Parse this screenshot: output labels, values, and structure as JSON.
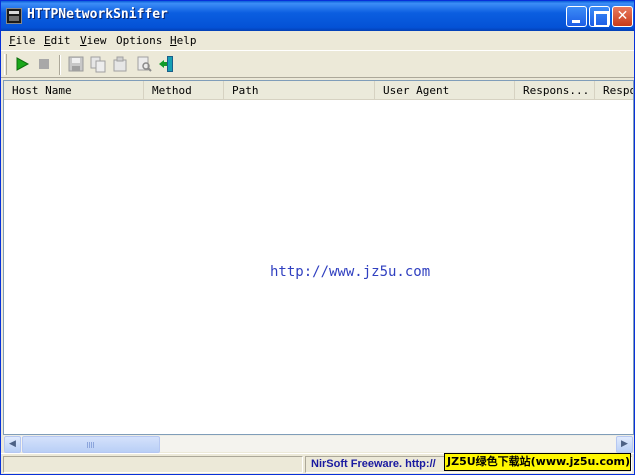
{
  "window": {
    "title": "HTTPNetworkSniffer"
  },
  "menu": [
    {
      "key": "F",
      "rest": "ile"
    },
    {
      "key": "E",
      "rest": "dit"
    },
    {
      "key": "V",
      "rest": "iew"
    },
    {
      "pre": "O",
      "rest": "ptions"
    },
    {
      "key": "H",
      "rest": "elp"
    }
  ],
  "toolbar": {
    "icons": [
      "start-capture-icon",
      "stop-capture-icon",
      "save-icon",
      "copy-icon",
      "properties-icon",
      "find-icon",
      "exit-icon"
    ],
    "colors": {
      "start": "#1aa81a",
      "disabled": "#a0a0a0",
      "exit": "#16a0b4"
    }
  },
  "list": {
    "columns": [
      "Host Name",
      "Method",
      "Path",
      "User Agent",
      "Respons...",
      "Respon"
    ],
    "rows": []
  },
  "watermark": "http://www.jz5u.com",
  "status": {
    "left": "",
    "right": "NirSoft Freeware.  http://",
    "badge": "JZ5U绿色下载站(www.jz5u.com)"
  }
}
